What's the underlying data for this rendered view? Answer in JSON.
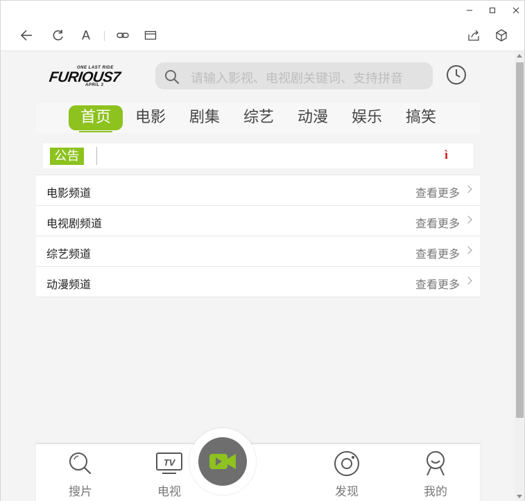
{
  "window": {
    "minimize": "–",
    "maximize": "□",
    "close": "×"
  },
  "toolbar": {
    "font_label": "A"
  },
  "logo": {
    "top": "ONE LAST RIDE",
    "main": "FURIOUS7",
    "bottom": "APRIL 3"
  },
  "search": {
    "placeholder": "请输入影视、电视剧关键词、支持拼音"
  },
  "nav": {
    "items": [
      {
        "label": "首页"
      },
      {
        "label": "电影"
      },
      {
        "label": "剧集"
      },
      {
        "label": "综艺"
      },
      {
        "label": "动漫"
      },
      {
        "label": "娱乐"
      },
      {
        "label": "搞笑"
      }
    ]
  },
  "notice": {
    "badge": "公告",
    "mark": "ì"
  },
  "channels": [
    {
      "title": "电影频道",
      "more": "查看更多"
    },
    {
      "title": "电视剧频道",
      "more": "查看更多"
    },
    {
      "title": "综艺频道",
      "more": "查看更多"
    },
    {
      "title": "动漫频道",
      "more": "查看更多"
    }
  ],
  "tabbar": {
    "items": [
      {
        "label": "搜片",
        "icon": "search-icon"
      },
      {
        "label": "电视",
        "icon": "tv-icon"
      },
      {
        "label": "",
        "icon": "video-camera-icon"
      },
      {
        "label": "发现",
        "icon": "discover-icon"
      },
      {
        "label": "我的",
        "icon": "user-icon"
      }
    ],
    "tv_badge": "TV"
  },
  "colors": {
    "accent": "#8dc21f",
    "notice_mark": "#d61818"
  }
}
